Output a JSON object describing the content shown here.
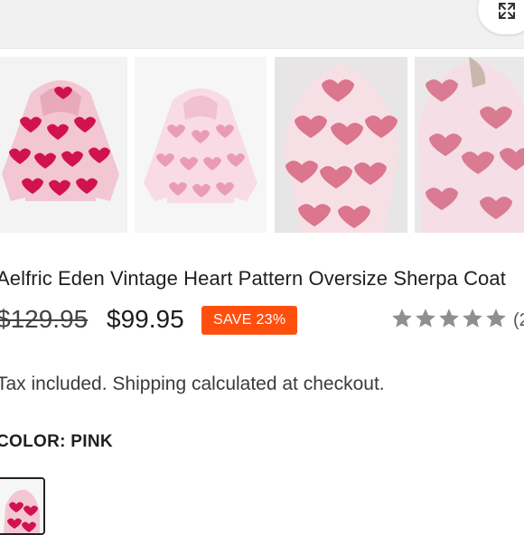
{
  "product": {
    "title": "Aelfric Eden Vintage Heart Pattern Oversize Sherpa Coat",
    "original_price": "$129.95",
    "sale_price": "$99.95",
    "discount_badge": "SAVE 23%",
    "rating": 5,
    "review_count_visible": "(2",
    "tax_note": "Tax included. Shipping calculated at checkout.",
    "color_label": "COLOR: PINK"
  },
  "gallery": {
    "images": [
      {
        "name": "hoodie-deep-pink-hearts",
        "body_color": "#f3c6d3",
        "heart_color": "#d0134f"
      },
      {
        "name": "hoodie-light-pink-hearts",
        "body_color": "#f9dbe5",
        "heart_color": "#ea9cb6"
      },
      {
        "name": "hoodie-back-view-worn",
        "body_color": "#f6e0e6",
        "heart_color": "#d8637f"
      },
      {
        "name": "hoodie-side-view-worn",
        "body_color": "#f5dee5",
        "heart_color": "#d56a85"
      }
    ]
  },
  "colors": {
    "accent": "#ff4f0f",
    "star": "#8f8f8f"
  },
  "icons": {
    "expand": "expand-arrows-icon",
    "star": "star-icon"
  }
}
